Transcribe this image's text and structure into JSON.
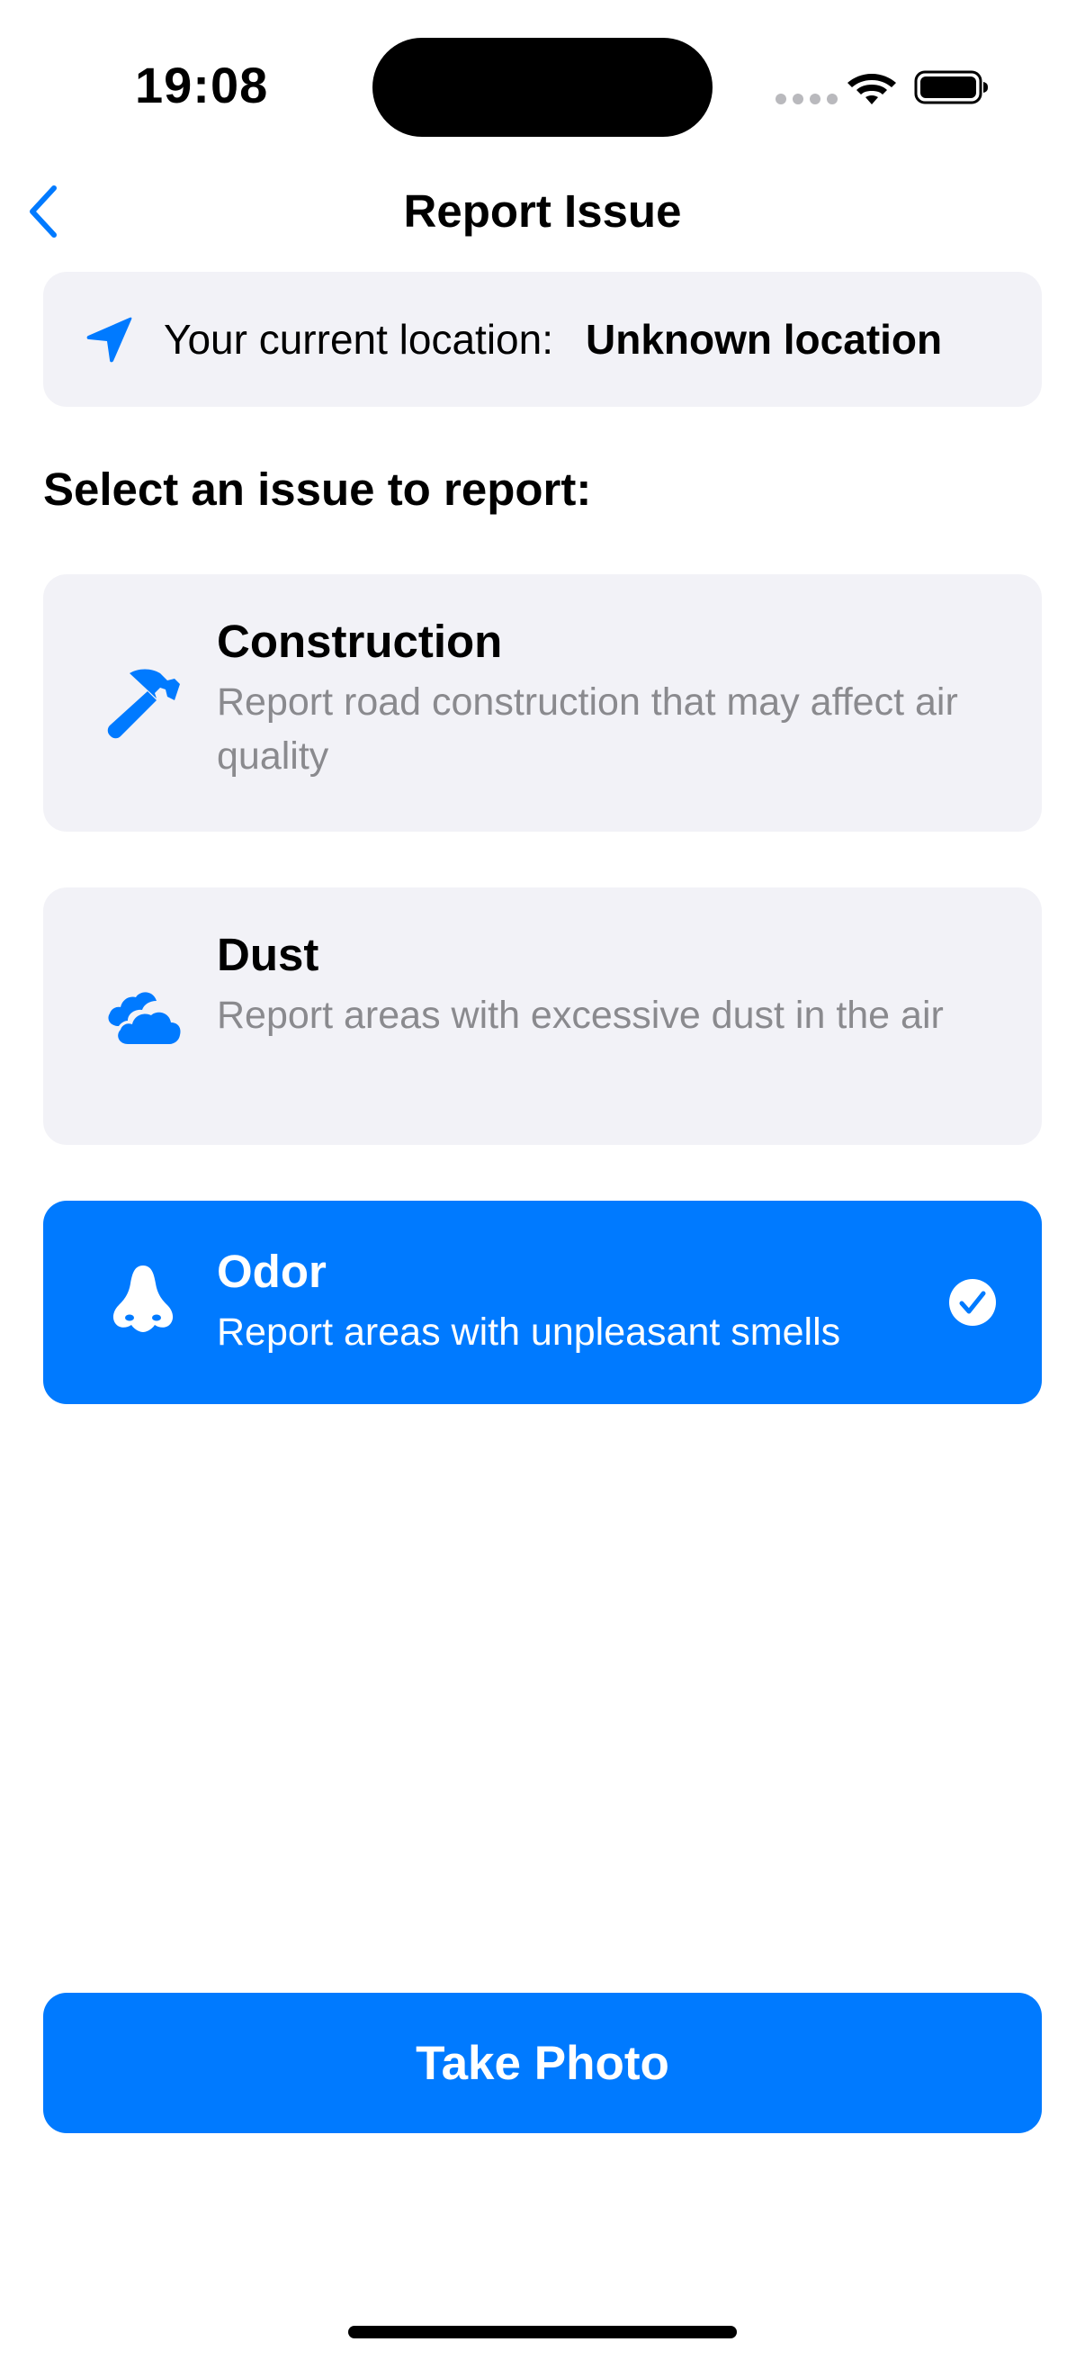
{
  "status_bar": {
    "time": "19:08",
    "wifi_icon": "wifi-icon",
    "battery_icon": "battery-icon"
  },
  "nav": {
    "back_icon": "chevron-left-icon",
    "title": "Report Issue"
  },
  "location": {
    "icon": "location-arrow-icon",
    "prefix": "Your current location:",
    "value": "Unknown location"
  },
  "section_heading": "Select an issue to report:",
  "issues": [
    {
      "icon": "hammer-icon",
      "title": "Construction",
      "description": "Report road construction that may affect air quality",
      "selected": false
    },
    {
      "icon": "cloud-icon",
      "title": "Dust",
      "description": "Report areas with excessive dust in the air",
      "selected": false
    },
    {
      "icon": "nose-icon",
      "title": "Odor",
      "description": "Report areas with unpleasant smells",
      "selected": true
    }
  ],
  "take_photo_label": "Take Photo",
  "colors": {
    "accent": "#007aff",
    "card_background": "#f2f2f7",
    "secondary_text": "#8a8a8e"
  }
}
